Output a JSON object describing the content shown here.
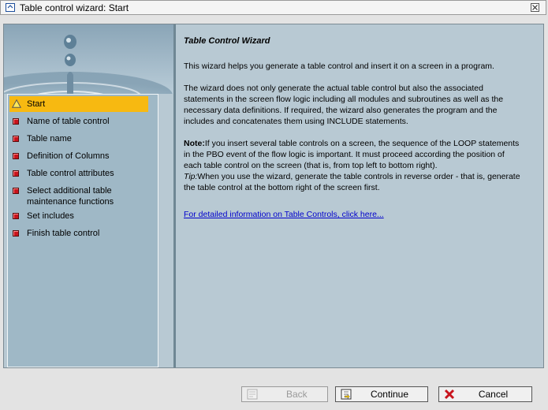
{
  "window": {
    "title": "Table control wizard: Start"
  },
  "steps": [
    {
      "label": "Start",
      "active": true,
      "icon": "warning-triangle-icon"
    },
    {
      "label": "Name of table control",
      "icon": "red-square-icon"
    },
    {
      "label": "Table name",
      "icon": "red-square-icon"
    },
    {
      "label": "Definition of Columns",
      "icon": "red-square-icon"
    },
    {
      "label": "Table control attributes",
      "icon": "red-square-icon"
    },
    {
      "label": "Select additional table maintenance functions",
      "icon": "red-square-icon"
    },
    {
      "label": "Set includes",
      "icon": "red-square-icon"
    },
    {
      "label": "Finish table control",
      "icon": "red-square-icon"
    }
  ],
  "content": {
    "heading": "Table Control Wizard",
    "p1": "This wizard helps you generate a table control and insert it on a screen in a program.",
    "p2": "The wizard does not only generate the actual table control but also the associated statements in the screen flow logic including all modules and subroutines as well as the necessary data definitions. If required, the wizard also generates the program and the includes and concatenates them using INCLUDE statements.",
    "note_label": "Note:",
    "note_text": "If you insert several table controls on a screen, the sequence of the LOOP statements in the PBO event of the flow logic is important. It must proceed according the position of each table control on the screen (that is, from top left to bottom right).",
    "tip_label": "Tip:",
    "tip_text": "When you use the wizard, generate the table controls in reverse order - that is, generate the table control at the bottom right of the screen first.",
    "link": "For detailed information on Table Controls, click here..."
  },
  "buttons": {
    "back": "Back",
    "continue": "Continue",
    "cancel": "Cancel"
  },
  "colors": {
    "active_step": "#f7b911",
    "step_marker": "#c8141d",
    "pane_bg": "#b8c9d3",
    "link": "#0000cc"
  }
}
